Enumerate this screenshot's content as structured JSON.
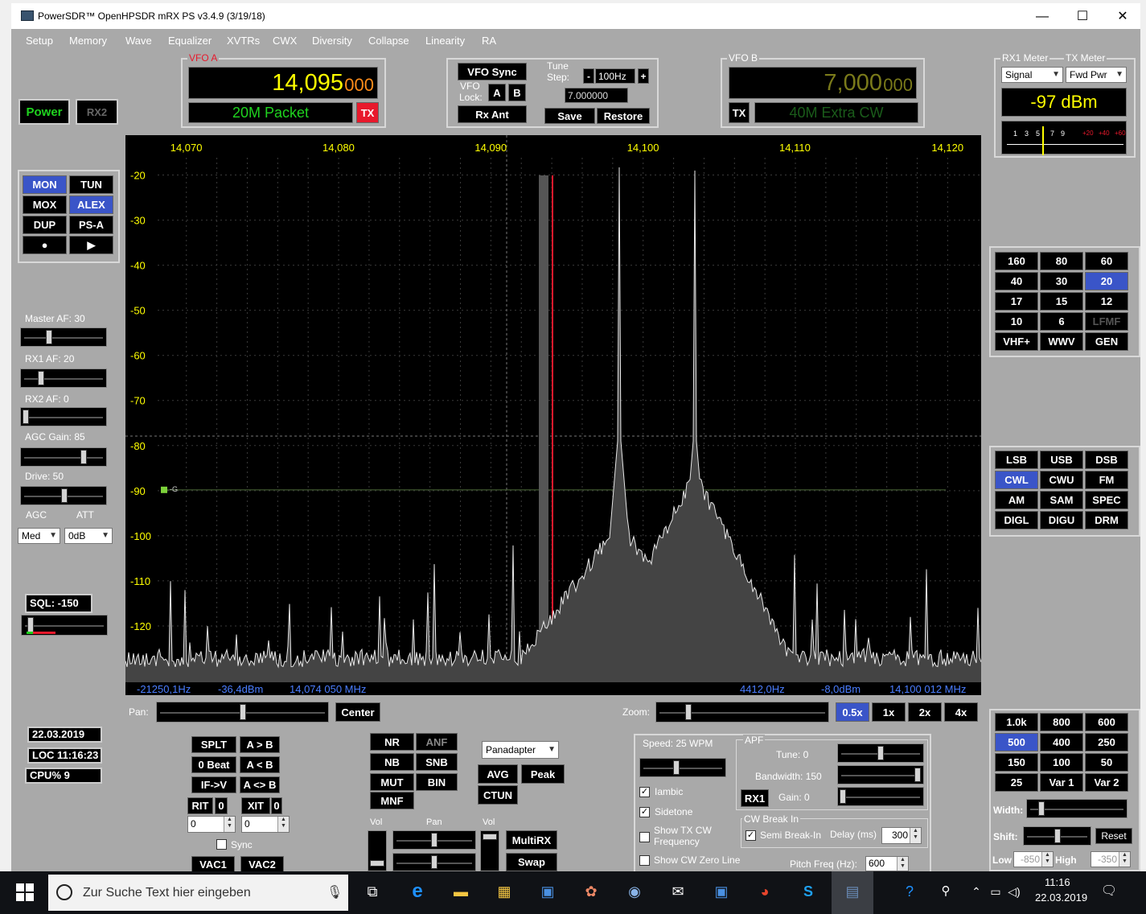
{
  "window": {
    "title": "PowerSDR™ OpenHPSDR mRX PS v3.4.9 (3/19/18)",
    "min": "—",
    "max": "☐",
    "close": "✕"
  },
  "menu": [
    "Setup",
    "Memory",
    "Wave",
    "Equalizer",
    "XVTRs",
    "CWX",
    "Diversity",
    "Collapse",
    "Linearity",
    "RA"
  ],
  "power": {
    "power_label": "Power",
    "rx2_label": "RX2"
  },
  "vfo_a": {
    "label": "VFO A",
    "freq_main": "14,095",
    "freq_sub": "000",
    "band_info": "20M Packet",
    "tx_label": "TX"
  },
  "vfo_ctrl": {
    "sync_label": "VFO Sync",
    "lock_label_1": "VFO",
    "lock_label_2": "Lock:",
    "a_label": "A",
    "b_label": "B",
    "rx_ant_label": "Rx Ant",
    "tune_label": "Tune",
    "step_label": "Step:",
    "step_minus": "-",
    "step_value": "100Hz",
    "step_plus": "+",
    "freq_field": "7.000000",
    "save_label": "Save",
    "restore_label": "Restore"
  },
  "vfo_b": {
    "label": "VFO B",
    "freq_main": "7,000",
    "freq_sub": "000",
    "band_info": "40M Extra CW",
    "tx_label": "TX"
  },
  "meter": {
    "rx_label": "RX1 Meter",
    "tx_label": "TX Meter",
    "rx_select": "Signal",
    "tx_select": "Fwd Pwr",
    "reading": "-97 dBm",
    "scale_white": [
      "1",
      "3",
      "5",
      "7",
      "9"
    ],
    "scale_red": [
      "+20",
      "+40",
      "+60"
    ]
  },
  "mode_buttons": [
    {
      "label": "MON",
      "on": true
    },
    {
      "label": "TUN",
      "on": false
    },
    {
      "label": "MOX",
      "on": false
    },
    {
      "label": "ALEX",
      "on": true
    },
    {
      "label": "DUP",
      "on": false
    },
    {
      "label": "PS-A",
      "on": false
    },
    {
      "label": "●",
      "on": false
    },
    {
      "label": "▶",
      "on": false
    }
  ],
  "left_controls": {
    "master_af": "Master AF:  30",
    "rx1_af": "RX1 AF:  20",
    "rx2_af": "RX2 AF:  0",
    "agc_gain": "AGC Gain:  85",
    "drive": "Drive:  50",
    "agc": "AGC",
    "att": "ATT",
    "agc_value": "Med",
    "att_value": "0dB",
    "sql": "SQL:  -150"
  },
  "freq_scale": [
    "14,070",
    "14,080",
    "14,090",
    "14,100",
    "14,110",
    "14,120"
  ],
  "db_scale": [
    "-20",
    "-30",
    "-40",
    "-50",
    "-60",
    "-70",
    "-80",
    "-90",
    "-100",
    "-110",
    "-120"
  ],
  "pan_marker": "-G",
  "pan_status": {
    "left_hz": "-21250,1Hz",
    "left_dbm": "-36,4dBm",
    "left_mhz": "14,074 050 MHz",
    "right_hz": "4412,0Hz",
    "right_dbm": "-8,0dBm",
    "right_mhz": "14,100 012 MHz"
  },
  "bands": [
    {
      "label": "160",
      "on": false,
      "dim": false
    },
    {
      "label": "80",
      "on": false,
      "dim": false
    },
    {
      "label": "60",
      "on": false,
      "dim": false
    },
    {
      "label": "40",
      "on": false,
      "dim": false
    },
    {
      "label": "30",
      "on": false,
      "dim": false
    },
    {
      "label": "20",
      "on": true,
      "dim": false
    },
    {
      "label": "17",
      "on": false,
      "dim": false
    },
    {
      "label": "15",
      "on": false,
      "dim": false
    },
    {
      "label": "12",
      "on": false,
      "dim": false
    },
    {
      "label": "10",
      "on": false,
      "dim": false
    },
    {
      "label": "6",
      "on": false,
      "dim": false
    },
    {
      "label": "LFMF",
      "on": false,
      "dim": true
    },
    {
      "label": "VHF+",
      "on": false,
      "dim": false
    },
    {
      "label": "WWV",
      "on": false,
      "dim": false
    },
    {
      "label": "GEN",
      "on": false,
      "dim": false
    }
  ],
  "modes": [
    {
      "label": "LSB",
      "on": false
    },
    {
      "label": "USB",
      "on": false
    },
    {
      "label": "DSB",
      "on": false
    },
    {
      "label": "CWL",
      "on": true
    },
    {
      "label": "CWU",
      "on": false
    },
    {
      "label": "FM",
      "on": false
    },
    {
      "label": "AM",
      "on": false
    },
    {
      "label": "SAM",
      "on": false
    },
    {
      "label": "SPEC",
      "on": false
    },
    {
      "label": "DIGL",
      "on": false
    },
    {
      "label": "DIGU",
      "on": false
    },
    {
      "label": "DRM",
      "on": false
    }
  ],
  "filters": [
    {
      "label": "1.0k",
      "on": false
    },
    {
      "label": "800",
      "on": false
    },
    {
      "label": "600",
      "on": false
    },
    {
      "label": "500",
      "on": true
    },
    {
      "label": "400",
      "on": false
    },
    {
      "label": "250",
      "on": false
    },
    {
      "label": "150",
      "on": false
    },
    {
      "label": "100",
      "on": false
    },
    {
      "label": "50",
      "on": false
    },
    {
      "label": "25",
      "on": false
    },
    {
      "label": "Var 1",
      "on": false
    },
    {
      "label": "Var 2",
      "on": false
    }
  ],
  "filter_ctrl": {
    "width": "Width:",
    "shift": "Shift:",
    "reset": "Reset",
    "low": "Low",
    "low_value": "-850",
    "high": "High",
    "high_value": "-350"
  },
  "pan_bar": {
    "pan": "Pan:",
    "center": "Center",
    "zoom": "Zoom:",
    "zooms": [
      {
        "label": "0.5x",
        "on": true
      },
      {
        "label": "1x",
        "on": false
      },
      {
        "label": "2x",
        "on": false
      },
      {
        "label": "4x",
        "on": false
      }
    ]
  },
  "clock": {
    "date": "22.03.2019",
    "loc": "LOC 11:16:23",
    "cpu": "CPU%  9"
  },
  "split_ctrl": {
    "splt": "SPLT",
    "a_to_b": "A > B",
    "zero_beat": "0 Beat",
    "a_lt_b": "A < B",
    "if_v": "IF->V",
    "a_swap_b": "A <> B",
    "rit": "RIT",
    "rit_val": "0",
    "xit": "XIT",
    "xit_val": "0",
    "rit_field": "0",
    "xit_field": "0",
    "sync": "Sync",
    "vac1": "VAC1",
    "vac2": "VAC2"
  },
  "dsp": {
    "nr": "NR",
    "anf": "ANF",
    "nb": "NB",
    "snb": "SNB",
    "mut": "MUT",
    "bin": "BIN",
    "mnf": "MNF"
  },
  "display_ctrl": {
    "mode": "Panadapter",
    "avg": "AVG",
    "peak": "Peak",
    "ctun": "CTUN",
    "vol1": "Vol",
    "pan": "Pan",
    "vol2": "Vol",
    "multirx": "MultiRX",
    "swap": "Swap"
  },
  "cw": {
    "speed": "Speed:  25 WPM",
    "iambic": "Iambic",
    "sidetone": "Sidetone",
    "show_tx_1": "Show TX CW",
    "show_tx_2": "Frequency",
    "show_zero": "Show CW Zero Line",
    "apf": "APF",
    "tune": "Tune:  0",
    "bandwidth": "Bandwidth:  150",
    "rx1": "RX1",
    "gain": "Gain:  0",
    "break_in": "CW Break In",
    "semi": "Semi Break-In",
    "delay": "Delay (ms)",
    "delay_value": "300",
    "pitch": "Pitch Freq (Hz):",
    "pitch_value": "600"
  },
  "taskbar": {
    "search": "Zur Suche Text hier eingeben",
    "time": "11:16",
    "date": "22.03.2019"
  },
  "colors": {
    "accent_on": "#3a55c8",
    "vfo_a_freq": "#ffff00",
    "vfo_a_sub": "#ff8c1a",
    "band_text": "#1fd31f",
    "tx_red": "#e8192c",
    "vfo_b_freq": "#7a7a1a",
    "pan_grid": "#3a3a3a",
    "pan_labels": "#ffff00",
    "status_blue": "#4a7dff"
  }
}
